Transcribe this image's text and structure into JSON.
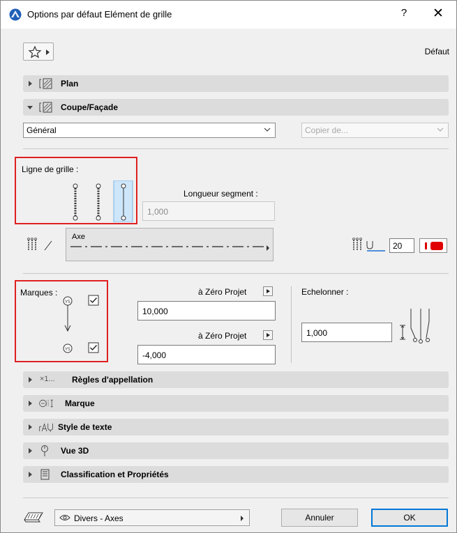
{
  "window": {
    "title": "Options par défaut Elément de grille",
    "help_glyph": "?",
    "close_glyph": "✕",
    "icon": "archicad-logo-icon"
  },
  "header": {
    "favorites_icon": "star-icon",
    "default_label": "Défaut"
  },
  "sections": {
    "plan": {
      "label": "Plan",
      "icon": "floor-plan-icon",
      "expanded": false
    },
    "coupe": {
      "label": "Coupe/Façade",
      "icon": "section-elevation-icon",
      "expanded": true
    },
    "regles": {
      "label": "Règles d'appellation",
      "icon_text": "×1...",
      "expanded": false
    },
    "marque": {
      "label": "Marque",
      "icon": "marker-icon",
      "expanded": false
    },
    "style": {
      "label": "Style de texte",
      "icon": "text-style-icon",
      "expanded": false
    },
    "vue3d": {
      "label": "Vue 3D",
      "icon": "3d-view-icon",
      "expanded": false
    },
    "classif": {
      "label": "Classification et Propriétés",
      "icon": "document-list-icon",
      "expanded": false
    }
  },
  "coupe_panel": {
    "view_select": "Général",
    "copy_from_placeholder": "Copier de...",
    "grid_line_label": "Ligne de grille :",
    "grid_line_options": [
      "both-markers",
      "short-segments",
      "single-segment"
    ],
    "grid_line_selected_index": 2,
    "segment_length_label": "Longueur segment :",
    "segment_length_value": "1,000",
    "line_type_name": "Axe",
    "pen_number": "20",
    "pen_color": "#e00000"
  },
  "markers": {
    "label": "Marques :",
    "top_checked": true,
    "bottom_checked": true,
    "top_ref_label": "à Zéro Projet",
    "top_value": "10,000",
    "bottom_ref_label": "à Zéro Projet",
    "bottom_value": "-4,000",
    "stagger_label": "Echelonner :",
    "stagger_value": "1,000"
  },
  "footer": {
    "layer_icon": "layers-icon",
    "layer_value": "Divers - Axes",
    "cancel_label": "Annuler",
    "ok_label": "OK"
  },
  "colors": {
    "highlight_red": "#e02020",
    "accent_blue": "#0078d7",
    "selected_option_bg": "#cde6fa"
  }
}
